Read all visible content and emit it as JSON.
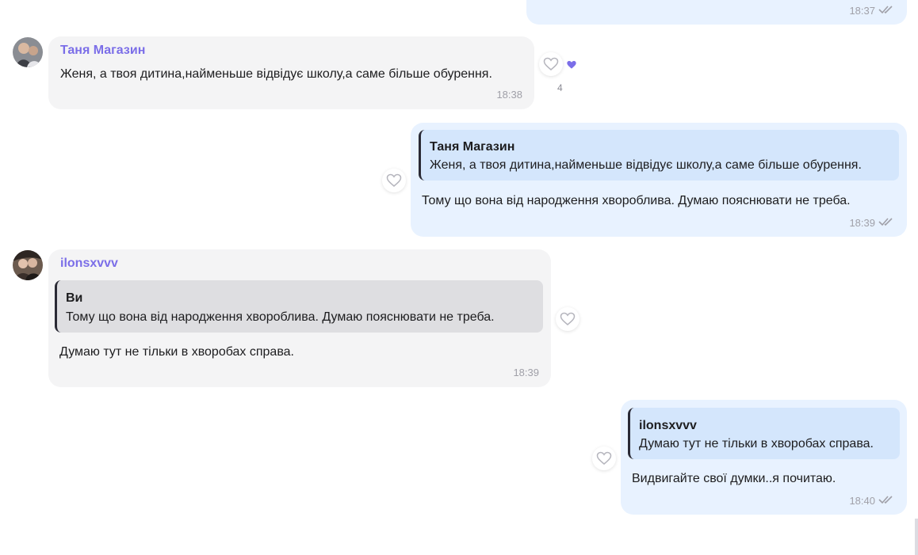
{
  "colors": {
    "incoming_bubble": "#f4f4f5",
    "outgoing_bubble": "#e8f2ff",
    "sender_name": "#7b6ee8",
    "reaction_heart": "#7b6ee8"
  },
  "messages": [
    {
      "direction": "out",
      "time": "18:37",
      "status_icon": "double-check-icon"
    },
    {
      "direction": "in",
      "sender": "Таня Магазин",
      "text": "Женя, а твоя дитина,найменьше відвідує школу,а саме більше обурення.",
      "time": "18:38",
      "reaction_icon": "heart-filled-icon",
      "reaction_count": "4"
    },
    {
      "direction": "out",
      "quote_name": "Таня Магазин",
      "quote_text": "Женя, а твоя дитина,найменьше відвідує школу,а саме більше обурення.",
      "text": "Тому що вона від народження хвороблива. Думаю пояснювати не треба.",
      "time": "18:39",
      "status_icon": "double-check-icon"
    },
    {
      "direction": "in",
      "sender": "ilonsxvvv",
      "quote_name": "Ви",
      "quote_text": "Тому що вона від народження хвороблива. Думаю пояснювати не треба.",
      "text": "Думаю тут не тільки в хворобах справа.",
      "time": "18:39"
    },
    {
      "direction": "out",
      "quote_name": "ilonsxvvv",
      "quote_text": "Думаю тут не тільки в хворобах справа.",
      "text": "Видвигайте свої думки..я почитаю.",
      "time": "18:40",
      "status_icon": "double-check-icon"
    }
  ]
}
